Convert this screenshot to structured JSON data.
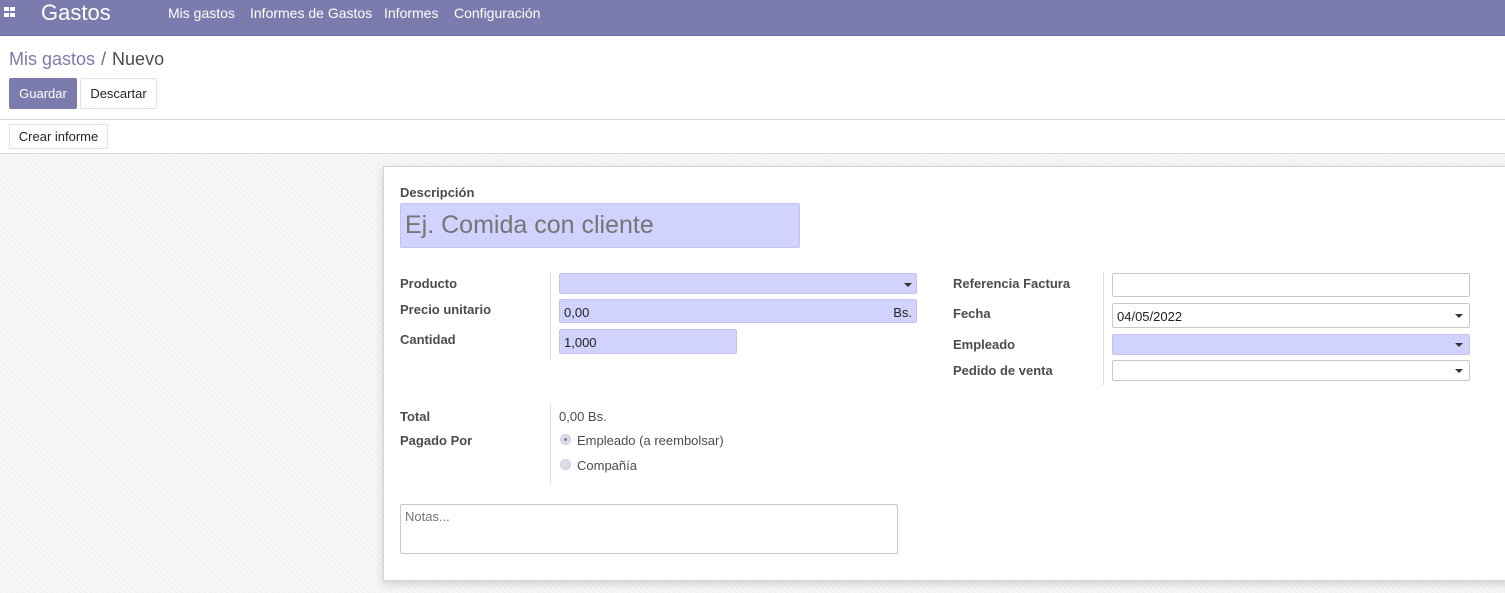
{
  "navbar": {
    "app_title": "Gastos",
    "menu": [
      "Mis gastos",
      "Informes de Gastos",
      "Informes",
      "Configuración"
    ]
  },
  "breadcrumb": {
    "parent": "Mis gastos",
    "separator": "/",
    "current": "Nuevo"
  },
  "actions": {
    "save": "Guardar",
    "discard": "Descartar",
    "create_report": "Crear informe"
  },
  "form": {
    "description_label": "Descripción",
    "description_placeholder": "Ej. Comida con cliente",
    "product_label": "Producto",
    "product_value": "",
    "unit_price_label": "Precio unitario",
    "unit_price_value": "0,00",
    "currency": "Bs.",
    "quantity_label": "Cantidad",
    "quantity_value": "1,000",
    "invoice_ref_label": "Referencia Factura",
    "invoice_ref_value": "",
    "date_label": "Fecha",
    "date_value": "04/05/2022",
    "employee_label": "Empleado",
    "employee_value": "",
    "sale_order_label": "Pedido de venta",
    "sale_order_value": "",
    "total_label": "Total",
    "total_value": "0,00 Bs.",
    "paid_by_label": "Pagado Por",
    "paid_by_options": [
      "Empleado (a reembolsar)",
      "Compañía"
    ],
    "paid_by_selected": "Empleado (a reembolsar)",
    "notes_placeholder": "Notas..."
  },
  "colors": {
    "brand": "#7c7bad",
    "required_field": "#d2d2ff"
  }
}
